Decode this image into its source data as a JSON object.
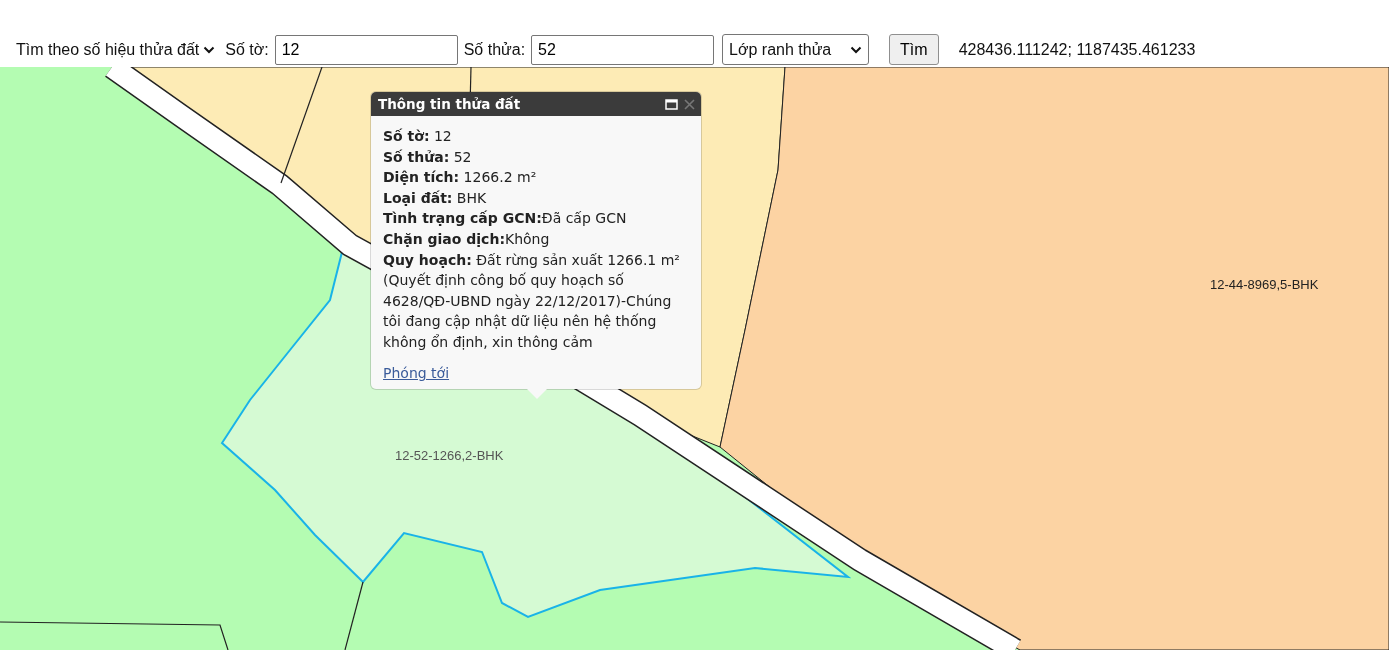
{
  "toolbar": {
    "search_mode": "Tìm theo số hiệu thửa đất",
    "sheet_label": "Số tờ:",
    "sheet_value": "12",
    "parcel_label": "Số thửa:",
    "parcel_value": "52",
    "layer": "Lớp ranh thửa",
    "search_button": "Tìm",
    "coordinates": "428436.111242; 1187435.461233"
  },
  "popup": {
    "title": "Thông tin thửa đất",
    "lines": [
      "**Số tờ:** 12",
      "**Số thửa:** 52",
      "**Diện tích:** 1266.2 m²",
      "**Loại đất:** BHK",
      "**Tình trạng cấp GCN:**Đã cấp GCN",
      "**Chặn giao dịch:**Không",
      "**Quy hoạch:** Đất rừng sản xuất 1266.1 m²"
    ],
    "note": "(Quyết định công bố quy hoạch số 4628/QĐ-UBND ngày 22/12/2017)-Chúng tôi đang cập nhật dữ liệu nên hệ thống không ổn định, xin thông cảm",
    "link": "Phóng tới"
  },
  "map_labels": [
    "12-44-8969,5-BHK",
    "12-52-1266,2-BHK"
  ]
}
